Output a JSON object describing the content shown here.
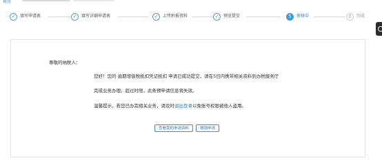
{
  "breadcrumb": {
    "first": "首页"
  },
  "steps": [
    {
      "label": "填写申请表",
      "state": "done",
      "icon": "check-icon"
    },
    {
      "label": "填写详细申请表",
      "state": "done",
      "icon": "check-icon"
    },
    {
      "label": "上传附报资料",
      "state": "done",
      "icon": "check-icon"
    },
    {
      "label": "预览提交",
      "state": "done",
      "icon": "check-icon"
    },
    {
      "label": "审核中",
      "state": "current",
      "number": "5"
    },
    {
      "label": "完成",
      "state": "todo",
      "number": "6"
    }
  ],
  "message": {
    "salutation": "尊敬的纳税人：",
    "line1": "您好！您的 逾期增值税抵扣凭证抵扣 申请已成功提交，请在5日内携带相关资料到办税服务厅",
    "line2": "完成业务办理。超过时限，此条预申请信息将失效。",
    "line3_before": "温馨提示，若您已办完相关业务，请及时",
    "line3_link": "退出登录",
    "line3_after": "以免账号权限被他人盗用。"
  },
  "buttons": {
    "view": "查看我的申请资料",
    "cancel": "撤销申请"
  },
  "colors": {
    "accent": "#3f9bde",
    "link": "#2a7fd0",
    "border": "#e3e3e3"
  }
}
